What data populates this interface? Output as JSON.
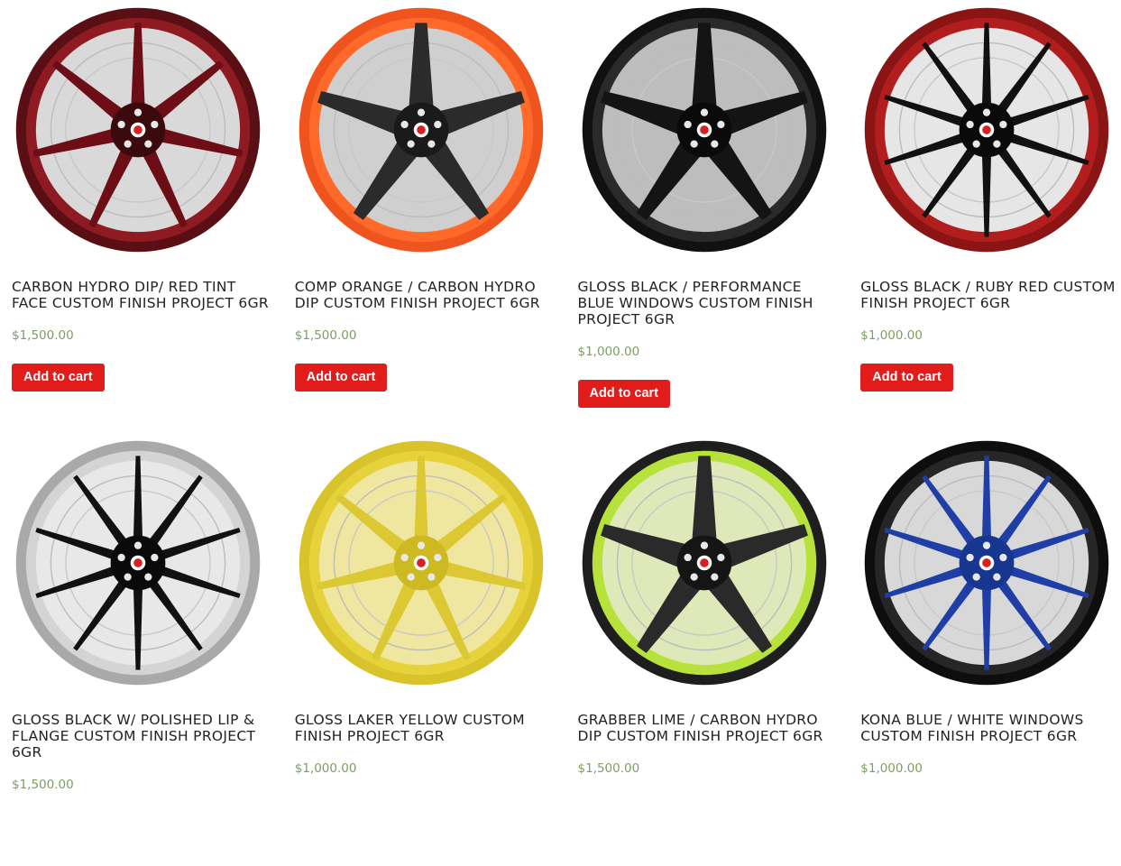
{
  "products": [
    {
      "title": "CARBON HYDRO DIP/ RED TINT FACE CUSTOM FINISH PROJECT 6GR",
      "price": "$1,500.00",
      "button": "Add to cart",
      "colors": {
        "rim": "#5a0f14",
        "lip": "#8e1a22",
        "spoke": "#6d0d15",
        "hub": "#3a0a0d",
        "barrel": "#d9d9d9"
      },
      "spokes": 7
    },
    {
      "title": "COMP ORANGE / CARBON HYDRO DIP CUSTOM FINISH PROJECT 6GR",
      "price": "$1,500.00",
      "button": "Add to cart",
      "colors": {
        "rim": "#f0541e",
        "lip": "#ff6a2a",
        "spoke": "#2b2b2b",
        "hub": "#1a1a1a",
        "barrel": "#cfcfcf"
      },
      "spokes": 5
    },
    {
      "title": "GLOSS BLACK / PERFORMANCE BLUE WINDOWS CUSTOM FINISH PROJECT 6GR",
      "price": "$1,000.00",
      "button": "Add to cart",
      "colors": {
        "rim": "#111111",
        "lip": "#2a2a2a",
        "spoke": "#141414",
        "hub": "#0a0a0a",
        "barrel": "#bdbdbd"
      },
      "spokes": 5
    },
    {
      "title": "GLOSS BLACK / RUBY RED CUSTOM FINISH PROJECT 6GR",
      "price": "$1,000.00",
      "button": "Add to cart",
      "colors": {
        "rim": "#8b1414",
        "lip": "#b21e1e",
        "spoke": "#111111",
        "hub": "#0a0a0a",
        "barrel": "#e6e6e6"
      },
      "spokes": 10
    },
    {
      "title": "GLOSS BLACK W/ POLISHED LIP & FLANGE CUSTOM FINISH PROJECT 6GR",
      "price": "$1,500.00",
      "button": "",
      "colors": {
        "rim": "#a9a9a9",
        "lip": "#d4d4d4",
        "spoke": "#111111",
        "hub": "#0a0a0a",
        "barrel": "#e8e8e8"
      },
      "spokes": 10
    },
    {
      "title": "GLOSS LAKER YELLOW CUSTOM FINISH PROJECT 6GR",
      "price": "$1,000.00",
      "button": "",
      "colors": {
        "rim": "#d8c42a",
        "lip": "#e6d23a",
        "spoke": "#dcc832",
        "hub": "#cdb922",
        "barrel": "#efe7a0"
      },
      "spokes": 7
    },
    {
      "title": "GRABBER LIME / CARBON HYDRO DIP CUSTOM FINISH PROJECT 6GR",
      "price": "$1,500.00",
      "button": "",
      "colors": {
        "rim": "#1e1e1e",
        "lip": "#b7e23c",
        "spoke": "#2a2a2a",
        "hub": "#151515",
        "barrel": "#dfe8b8"
      },
      "spokes": 5
    },
    {
      "title": "KONA BLUE / WHITE WINDOWS CUSTOM FINISH PROJECT 6GR",
      "price": "$1,000.00",
      "button": "",
      "colors": {
        "rim": "#0e0e0e",
        "lip": "#262626",
        "spoke": "#1f3fa6",
        "hub": "#173690",
        "barrel": "#d8d8d8"
      },
      "spokes": 10
    }
  ]
}
